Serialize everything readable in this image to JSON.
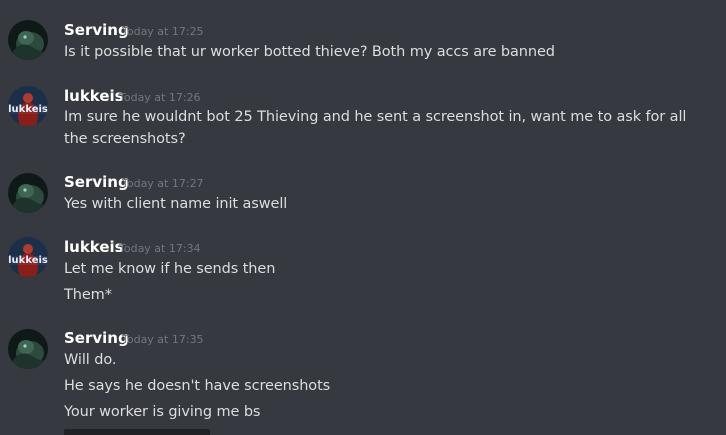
{
  "messages": [
    {
      "author": "Serving",
      "timestamp": "Today at 17:25",
      "avatar_icon": "dark-green-creature-avatar",
      "lines": [
        "Is it possible that ur worker botted thieve? Both my accs are banned"
      ]
    },
    {
      "author": "lukkeis",
      "timestamp": "Today at 17:26",
      "avatar_icon": "lukkeis-red-figure-avatar",
      "avatar_text": "lukkeis",
      "lines": [
        "Im sure he wouldnt bot 25 Thieving and he sent a screenshot in, want me to ask for all the screenshots?"
      ]
    },
    {
      "author": "Serving",
      "timestamp": "Today at 17:27",
      "avatar_icon": "dark-green-creature-avatar",
      "lines": [
        "Yes with client name init aswell"
      ]
    },
    {
      "author": "lukkeis",
      "timestamp": "Today at 17:34",
      "avatar_icon": "lukkeis-red-figure-avatar",
      "avatar_text": "lukkeis",
      "lines": [
        "Let me know if he sends then",
        "Them*"
      ]
    },
    {
      "author": "Serving",
      "timestamp": "Today at 17:35",
      "avatar_icon": "dark-green-creature-avatar",
      "lines": [
        "Will do.",
        "He says he doesn't have screenshots",
        "Your worker is giving me bs"
      ]
    }
  ],
  "colors": {
    "background": "#36393f",
    "username": "#ffffff",
    "message_text": "#dcddde",
    "timestamp": "#72767d"
  }
}
